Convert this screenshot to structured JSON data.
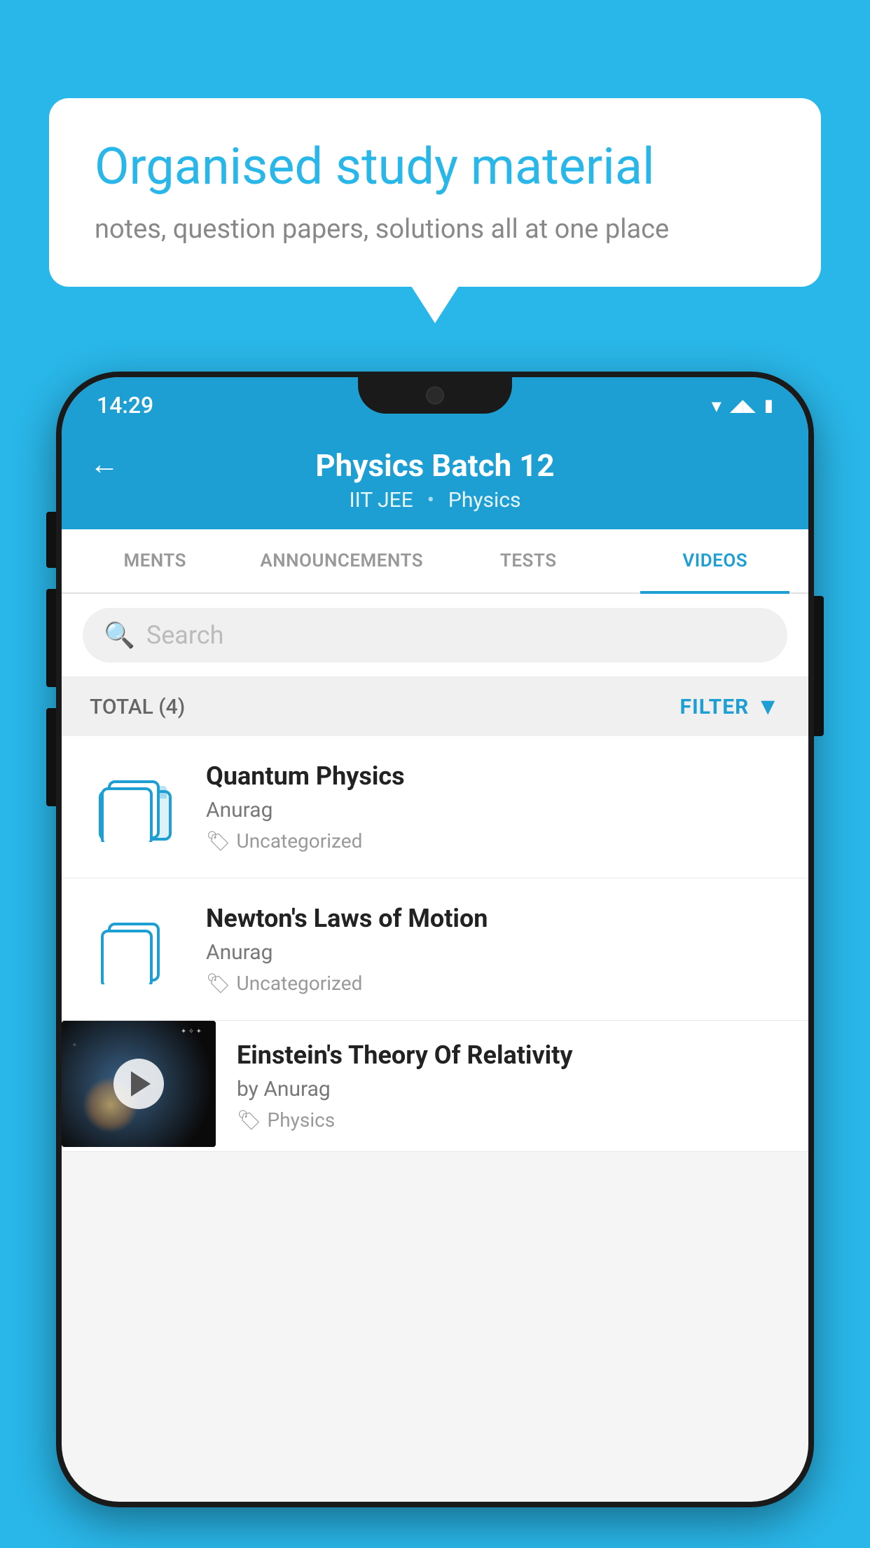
{
  "background_color": "#29b6e8",
  "bubble": {
    "title": "Organised study material",
    "subtitle": "notes, question papers, solutions all at one place"
  },
  "status_bar": {
    "time": "14:29",
    "icons": [
      "wifi",
      "signal",
      "battery"
    ]
  },
  "header": {
    "title": "Physics Batch 12",
    "breadcrumb_1": "IIT JEE",
    "breadcrumb_2": "Physics",
    "back_label": "←"
  },
  "tabs": [
    {
      "label": "MENTS",
      "active": false
    },
    {
      "label": "ANNOUNCEMENTS",
      "active": false
    },
    {
      "label": "TESTS",
      "active": false
    },
    {
      "label": "VIDEOS",
      "active": true
    }
  ],
  "search": {
    "placeholder": "Search"
  },
  "filter": {
    "total_label": "TOTAL (4)",
    "filter_label": "FILTER"
  },
  "videos": [
    {
      "id": 1,
      "title": "Quantum Physics",
      "author": "Anurag",
      "tag": "Uncategorized",
      "has_thumbnail": false
    },
    {
      "id": 2,
      "title": "Newton's Laws of Motion",
      "author": "Anurag",
      "tag": "Uncategorized",
      "has_thumbnail": false
    },
    {
      "id": 3,
      "title": "Einstein's Theory Of Relativity",
      "author": "by Anurag",
      "tag": "Physics",
      "has_thumbnail": true
    }
  ]
}
